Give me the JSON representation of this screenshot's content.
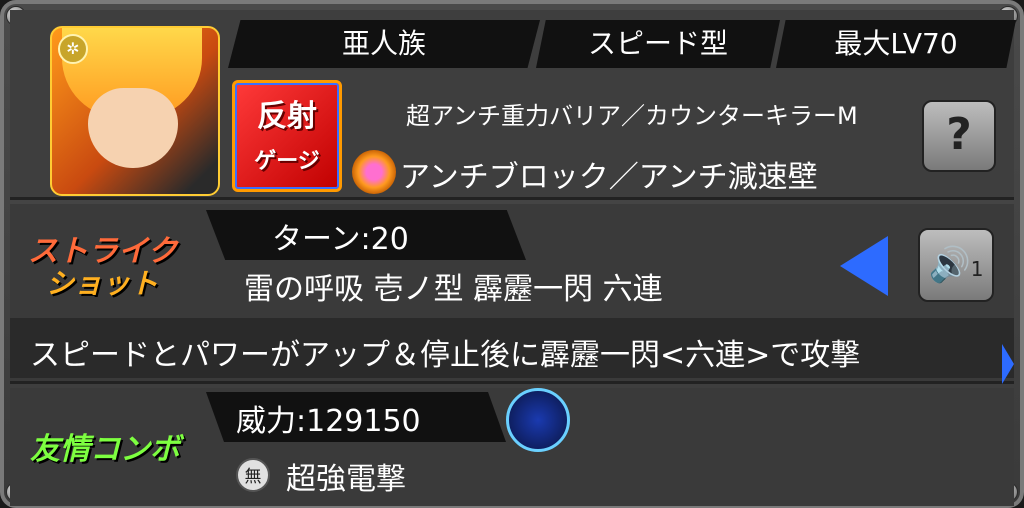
{
  "header": {
    "tribe": "亜人族",
    "battle_type": "スピード型",
    "max_level": "最大LV70"
  },
  "character": {
    "ability_badge": "反射",
    "ability_badge_sub": "ゲージ",
    "gauge_abilities": "超アンチ重力バリア／カウンターキラーM",
    "connect_abilities": "アンチブロック／アンチ減速壁",
    "help_icon": "?"
  },
  "strike_shot": {
    "title_line1": "ストライク",
    "title_line2": "ショット",
    "turns": "ターン:20",
    "name": "雷の呼吸 壱ノ型 霹靂一閃 六連",
    "description": "スピードとパワーがアップ＆停止後に霹靂一閃<六連>で攻撃",
    "sound_label": "1"
  },
  "friendship_combo": {
    "title": "友情コンボ",
    "power": "威力:129150",
    "sub_icon": "無",
    "name": "超強電撃"
  },
  "colors": {
    "accent_blue": "#2d6bff",
    "strike_orange": "#ff6a3a",
    "combo_green": "#7dff40"
  }
}
